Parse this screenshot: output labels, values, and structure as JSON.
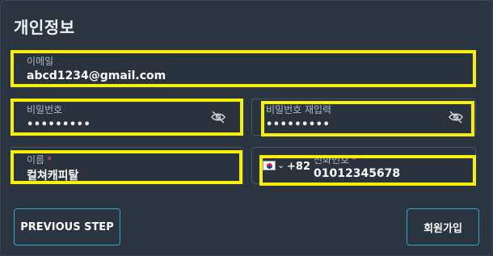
{
  "section": {
    "title": "개인정보"
  },
  "email": {
    "label": "이메일",
    "value": "abcd1234@gmail.com"
  },
  "password": {
    "label": "비밀번호",
    "value": "•••••••••",
    "toggle_icon": "eye-off-icon"
  },
  "password_confirm": {
    "label": "비밀번호 재입력",
    "value": "•••••••••",
    "toggle_icon": "eye-off-icon"
  },
  "name": {
    "label": "이름",
    "required_mark": "*",
    "value": "컬쳐캐피탈"
  },
  "phone": {
    "country_flag": "south-korea-flag-icon",
    "dial_code": "+82",
    "label": "전화번호",
    "required_mark": "*",
    "value": "01012345678"
  },
  "buttons": {
    "previous": "PREVIOUS STEP",
    "signup": "회원가입"
  },
  "colors": {
    "background": "#2b3441",
    "highlight": "#f7ee0a",
    "accent_border": "#33a7c8",
    "required": "#e0566a"
  }
}
